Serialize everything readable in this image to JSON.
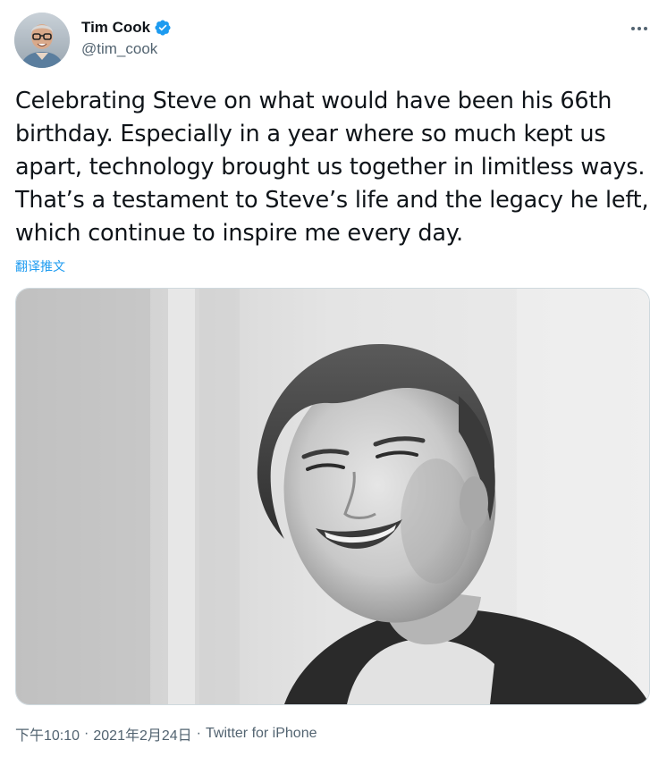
{
  "tweet": {
    "author": {
      "display_name": "Tim Cook",
      "handle": "@tim_cook",
      "verified": true,
      "avatar_icon": "avatar-photo"
    },
    "more_icon": "more-horizontal-icon",
    "text": "Celebrating Steve on what would have been his 66th birthday. Especially in a year where so much kept us apart, technology brought us together in limitless ways. That’s a testament to Steve’s life and the legacy he left, which continue to inspire me every day.",
    "translate_label": "翻译推文",
    "media": {
      "type": "photo",
      "style": "black-and-white portrait"
    },
    "meta": {
      "time": "下午10:10",
      "separator": "·",
      "date": "2021年2月24日",
      "source": "Twitter for iPhone"
    }
  },
  "colors": {
    "accent": "#1d9bf0",
    "secondary_text": "#536471",
    "primary_text": "#0f1419",
    "border": "#cfd9de"
  }
}
